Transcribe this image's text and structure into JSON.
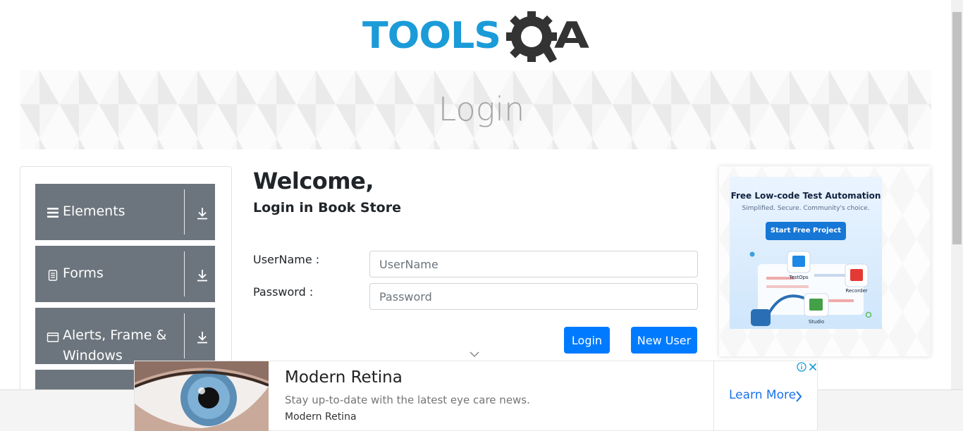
{
  "header": {
    "logo_part1": "TOOLS",
    "logo_part2": "QA",
    "colors": {
      "logo_blue": "#1b9bd8",
      "logo_dark": "#333333"
    }
  },
  "banner": {
    "title": "Login"
  },
  "sidebar": {
    "groups": [
      {
        "label": "Elements",
        "icon": "hamburger-icon"
      },
      {
        "label": "Forms",
        "icon": "document-icon"
      },
      {
        "label": "Alerts, Frame & Windows",
        "icon": "window-icon"
      }
    ],
    "expand_icon": "download-arrow-icon",
    "colors": {
      "group_bg": "#6c757d"
    }
  },
  "login": {
    "heading": "Welcome,",
    "subheading": "Login in Book Store",
    "username_label": "UserName :",
    "username_placeholder": "UserName",
    "password_label": "Password :",
    "password_placeholder": "Password",
    "login_button": "Login",
    "new_user_button": "New User",
    "colors": {
      "button_bg": "#007bff"
    }
  },
  "side_ad": {
    "title": "Free Low-code Test Automation",
    "subtitle": "Simplified. Secure. Community's choice.",
    "cta": "Start Free Project",
    "tiles": [
      "TestOps",
      "Recorder",
      "Studio"
    ]
  },
  "bottom_ad": {
    "headline": "Modern Retina",
    "description": "Stay up-to-date with the latest eye care news.",
    "brand": "Modern Retina",
    "cta": "Learn More",
    "colors": {
      "cta": "#1a73e8"
    }
  }
}
